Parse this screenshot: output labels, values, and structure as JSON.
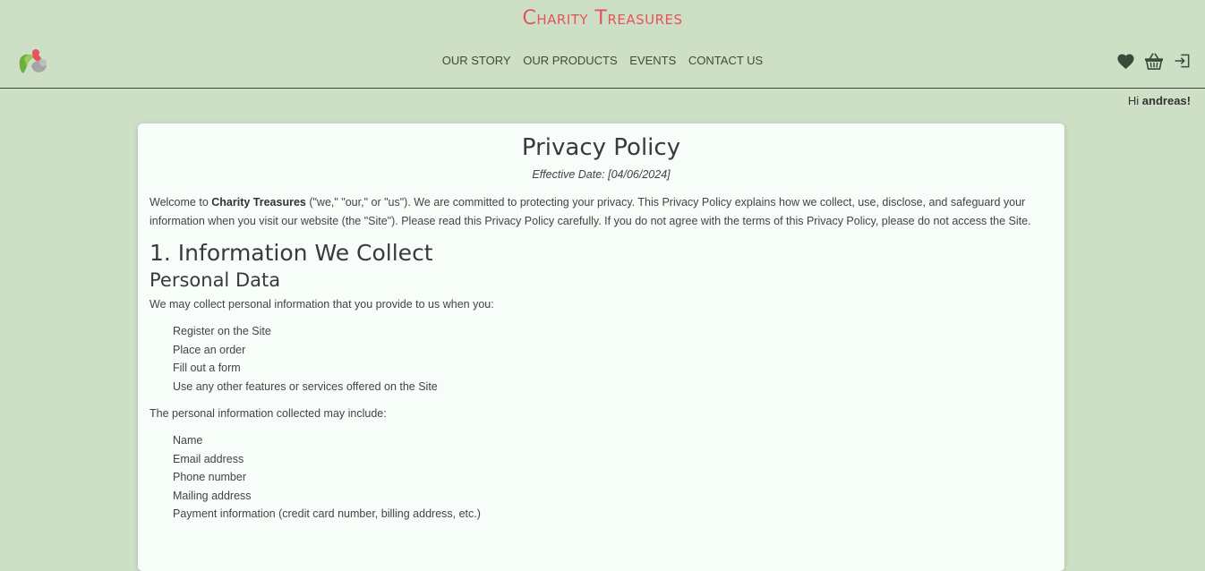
{
  "header": {
    "brand": "Charity Treasures",
    "nav": [
      "OUR STORY",
      "OUR PRODUCTS",
      "EVENTS",
      "CONTACT US"
    ],
    "icons": [
      "heart-icon",
      "basket-icon",
      "sign-in-icon"
    ]
  },
  "greeting": {
    "prefix": "Hi ",
    "user": "andreas!"
  },
  "policy": {
    "title": "Privacy Policy",
    "effective": "Effective Date: [04/06/2024]",
    "intro_pre": "Welcome to ",
    "intro_brand": "Charity Treasures",
    "intro_post": " (\"we,\" \"our,\" or \"us\"). We are committed to protecting your privacy. This Privacy Policy explains how we collect, use, disclose, and safeguard your information when you visit our website (the \"Site\"). Please read this Privacy Policy carefully. If you do not agree with the terms of this Privacy Policy, please do not access the Site.",
    "section1": "1. Information We Collect",
    "sub1": "Personal Data",
    "collect_intro": "We may collect personal information that you provide to us when you:",
    "collect_list": [
      "Register on the Site",
      "Place an order",
      "Fill out a form",
      "Use any other features or services offered on the Site"
    ],
    "include_intro": "The personal information collected may include:",
    "include_list": [
      "Name",
      "Email address",
      "Phone number",
      "Mailing address",
      "Payment information (credit card number, billing address, etc.)"
    ]
  },
  "colors": {
    "background": "#cde0c6",
    "brand": "#e5535b",
    "card": "#f7fdf8"
  }
}
